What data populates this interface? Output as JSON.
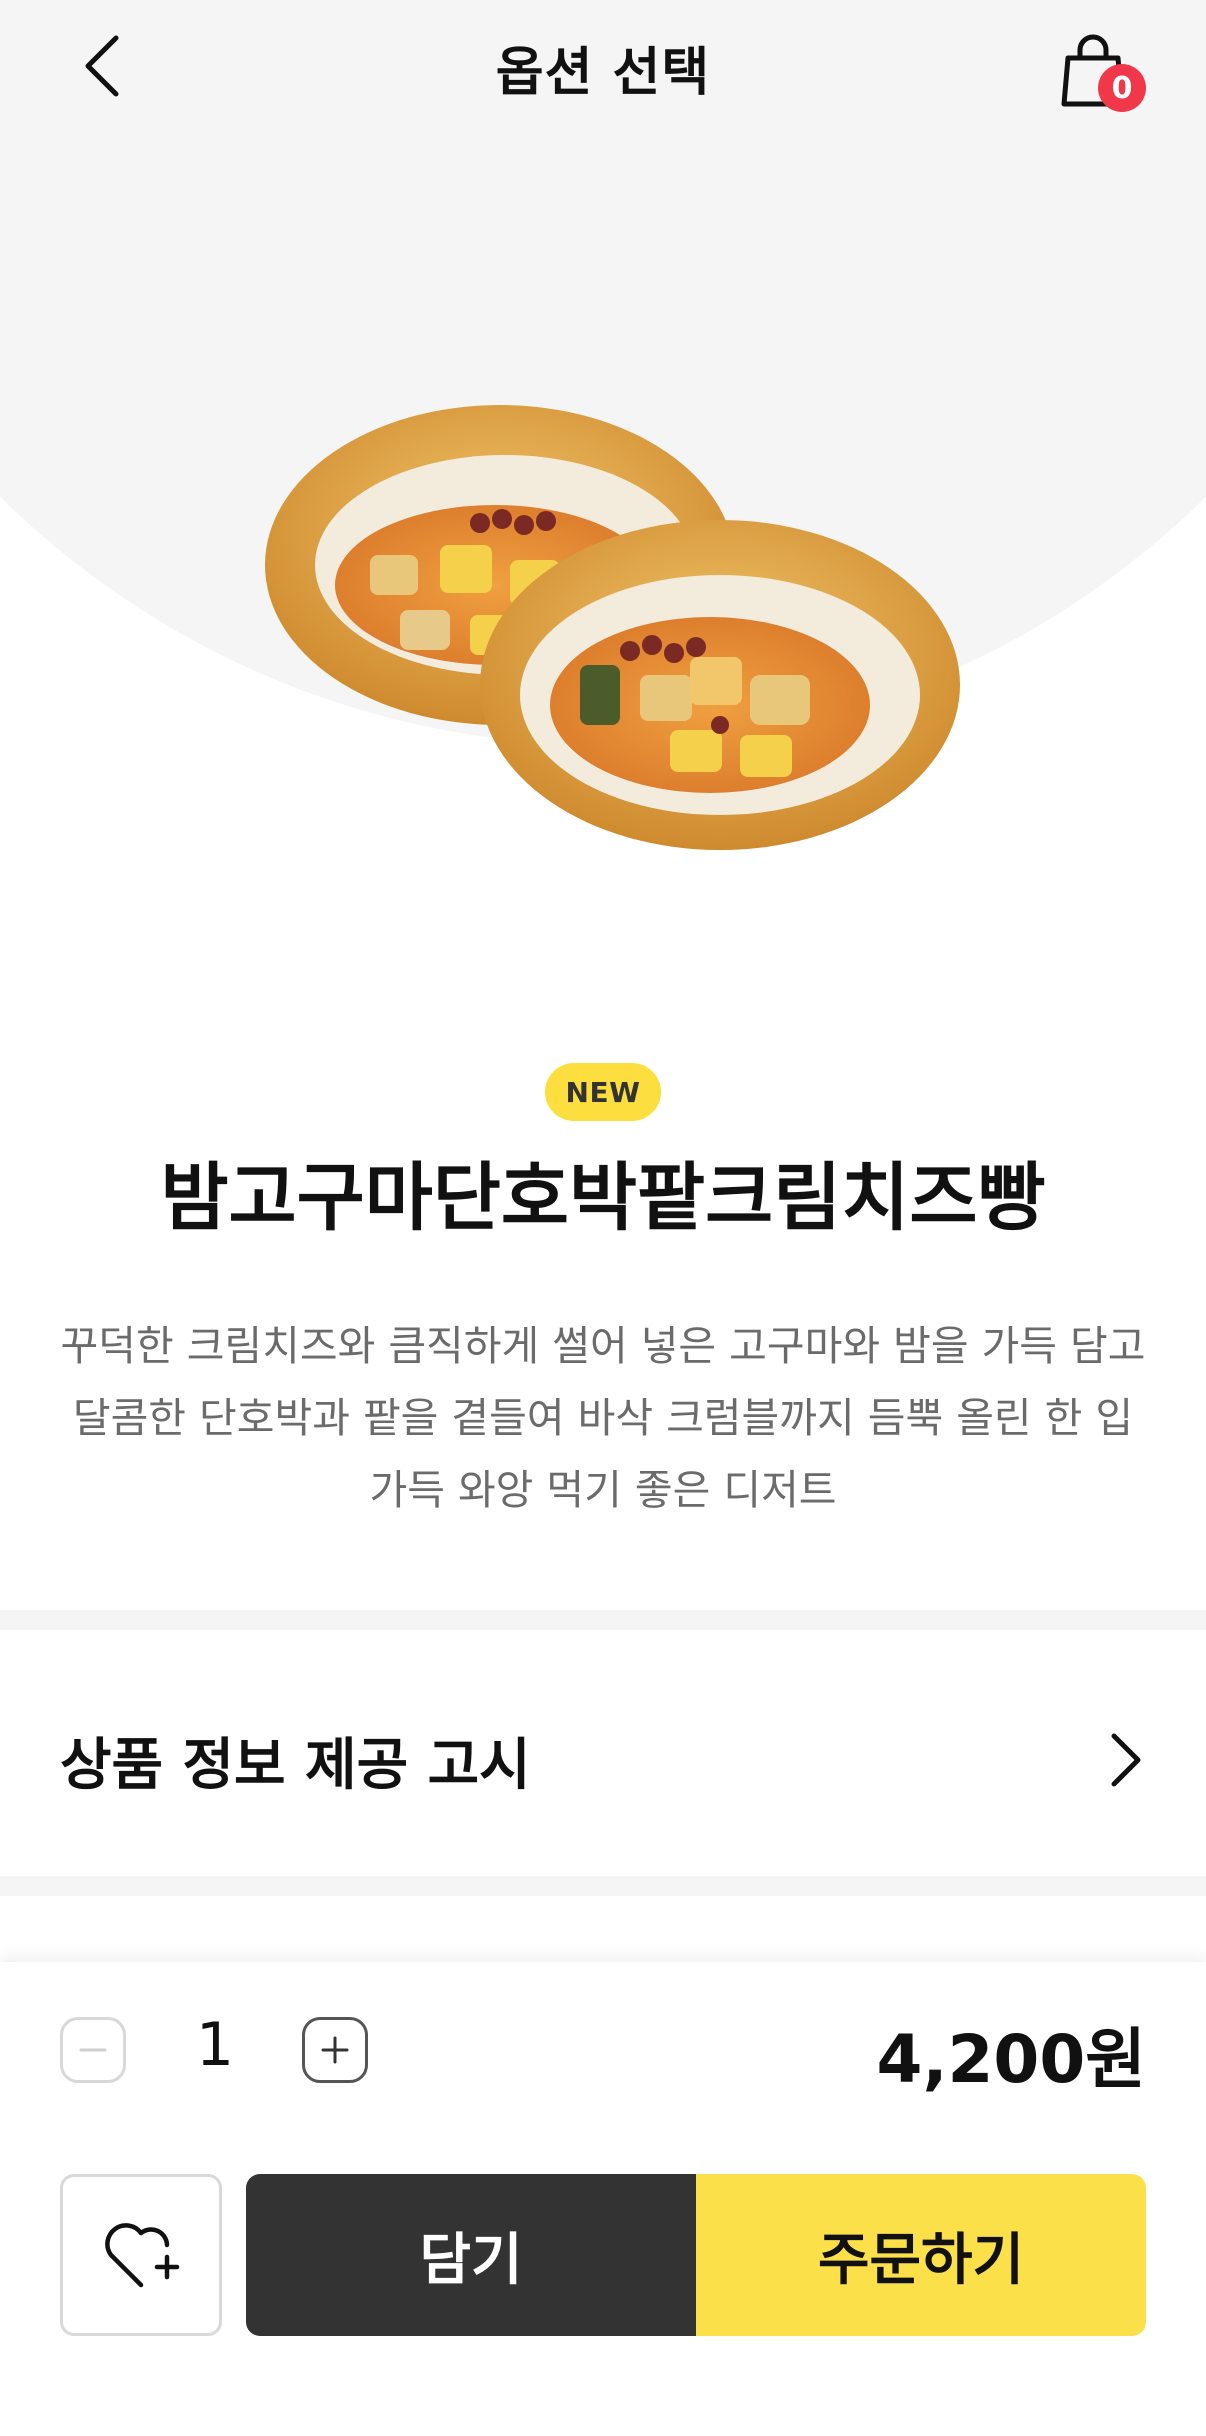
{
  "header": {
    "title": "옵션 선택",
    "back_icon": "chevron-left-icon",
    "cart_icon": "shopping-bag-icon",
    "cart_count": "0"
  },
  "product": {
    "image": "bread-icon",
    "badge": "NEW",
    "name": "밤고구마단호박팥크림치즈빵",
    "description": "꾸덕한 크림치즈와 큼직하게 썰어 넣은 고구마와 밤을 가득 담고 달콤한 단호박과 팥을 곁들여 바삭 크럼블까지 듬뿍 올린 한 입 가득 와앙 먹기 좋은 디저트"
  },
  "notice": {
    "label": "상품 정보 제공 고시",
    "chevron_icon": "chevron-right-icon"
  },
  "purchase": {
    "quantity": "1",
    "price": "4,200원",
    "add_to_cart_label": "담기",
    "order_label": "주문하기",
    "favorite_icon": "heart-plus-icon"
  },
  "colors": {
    "accent_yellow": "#fce04a",
    "badge_yellow": "#fcdf3f",
    "dark_button": "#333333",
    "cart_badge_red": "#f0384a",
    "hero_bg": "#f5f5f5"
  }
}
